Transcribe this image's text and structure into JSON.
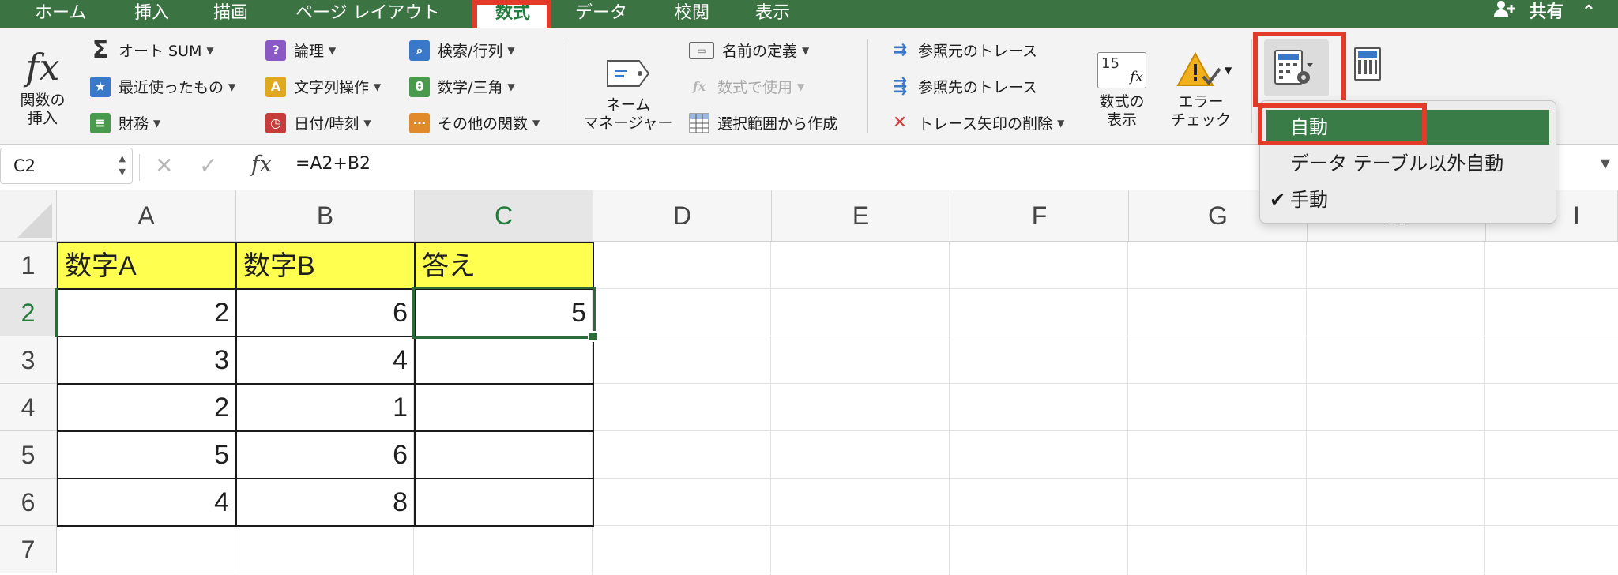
{
  "tabs": [
    {
      "label": "ホーム",
      "active": false
    },
    {
      "label": "挿入",
      "active": false
    },
    {
      "label": "描画",
      "active": false
    },
    {
      "label": "ページ レイアウト",
      "active": false
    },
    {
      "label": "数式",
      "active": true
    },
    {
      "label": "データ",
      "active": false
    },
    {
      "label": "校閲",
      "active": false
    },
    {
      "label": "表示",
      "active": false
    }
  ],
  "share_label": "共有",
  "ribbon": {
    "insert_function": {
      "line1": "関数の",
      "line2": "挿入"
    },
    "library": [
      {
        "label": "オート SUM",
        "icon": "sum-icon"
      },
      {
        "label": "最近使ったもの",
        "icon": "star-icon"
      },
      {
        "label": "財務",
        "icon": "finance-icon"
      },
      {
        "label": "論理",
        "icon": "logic-icon"
      },
      {
        "label": "文字列操作",
        "icon": "text-icon"
      },
      {
        "label": "日付/時刻",
        "icon": "clock-icon"
      },
      {
        "label": "検索/行列",
        "icon": "lookup-icon"
      },
      {
        "label": "数学/三角",
        "icon": "math-icon"
      },
      {
        "label": "その他の関数",
        "icon": "more-functions-icon"
      }
    ],
    "name_manager": {
      "line1": "ネーム",
      "line2": "マネージャー"
    },
    "names": [
      {
        "label": "名前の定義"
      },
      {
        "label": "数式で使用"
      },
      {
        "label": "選択範囲から作成"
      }
    ],
    "audit": [
      {
        "label": "参照元のトレース"
      },
      {
        "label": "参照先のトレース"
      },
      {
        "label": "トレース矢印の削除"
      }
    ],
    "show_formulas": {
      "line1": "数式の",
      "line2": "表示",
      "icon_text": "15"
    },
    "error_check": {
      "line1": "エラー",
      "line2": "チェック"
    }
  },
  "formula_bar": {
    "name_box": "C2",
    "formula": "=A2+B2"
  },
  "columns": [
    "A",
    "B",
    "C",
    "D",
    "E",
    "F",
    "G",
    "H",
    "I"
  ],
  "rows": [
    "1",
    "2",
    "3",
    "4",
    "5",
    "6",
    "7"
  ],
  "cells": {
    "headers": [
      "数字A",
      "数字B",
      "答え"
    ],
    "a": [
      "2",
      "3",
      "2",
      "5",
      "4"
    ],
    "b": [
      "6",
      "4",
      "1",
      "6",
      "8"
    ],
    "c2": "5"
  },
  "calc_menu": {
    "items": [
      {
        "label": "自動",
        "highlighted": true,
        "checked": false
      },
      {
        "label": "データ テーブル以外自動",
        "highlighted": false,
        "checked": false
      },
      {
        "label": "手動",
        "highlighted": false,
        "checked": true
      }
    ]
  },
  "colors": {
    "ribbon_green": "#3b7442",
    "highlight": "#e33a2a",
    "cell_yellow": "#ffff4f",
    "menu_highlight": "#3a7c48"
  }
}
